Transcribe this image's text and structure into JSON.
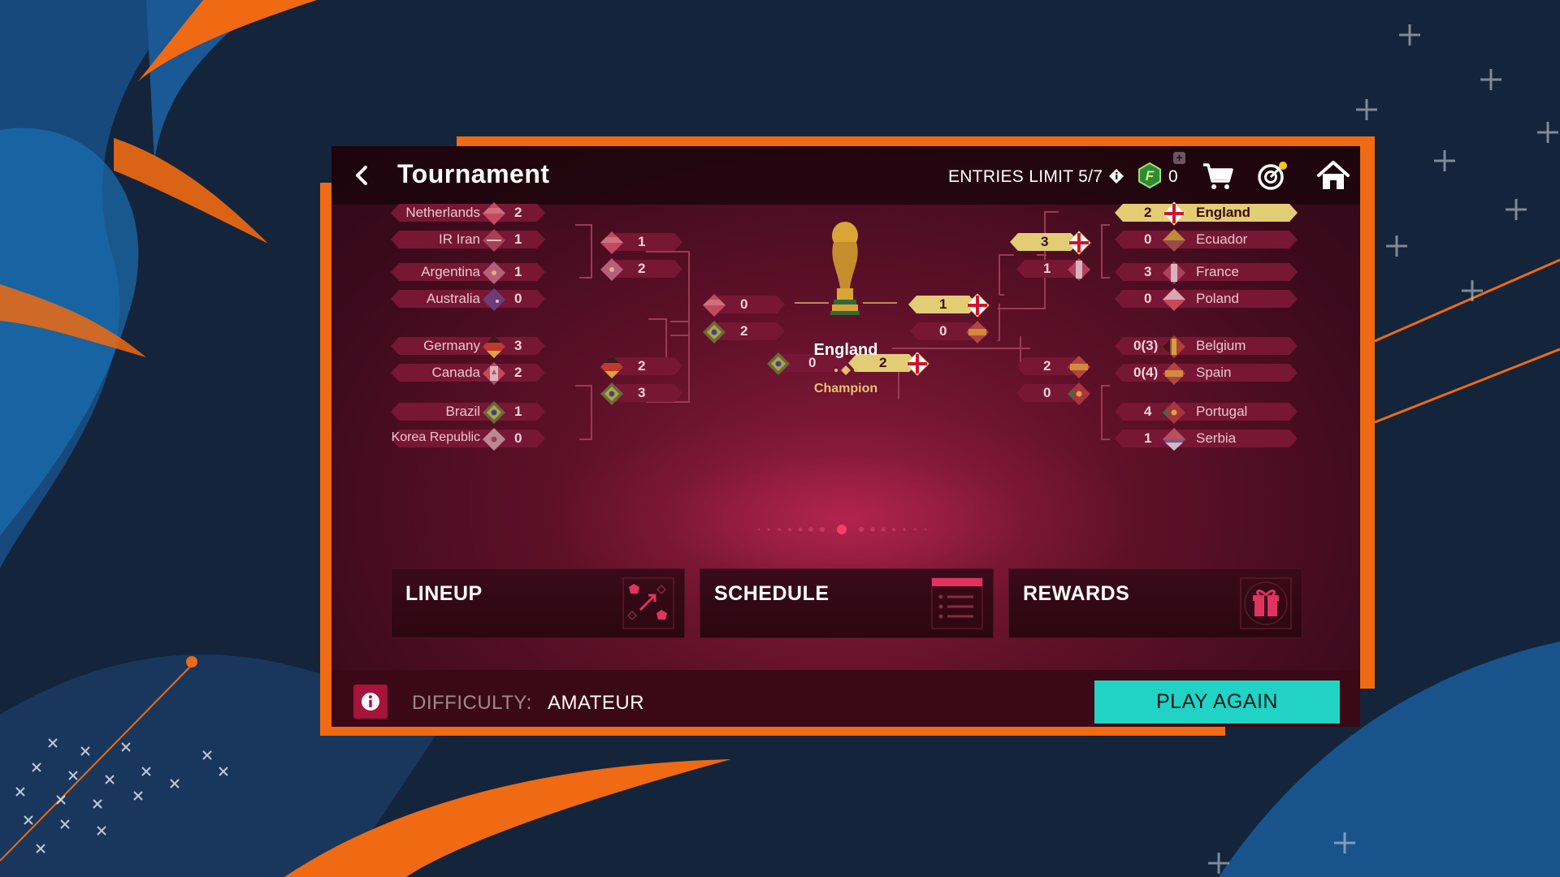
{
  "header": {
    "title": "Tournament",
    "entries_limit": "ENTRIES LIMIT 5/7",
    "coins": "0",
    "coin_plus": "+",
    "icons": [
      "back-arrow-icon",
      "info-icon",
      "fifa-points-icon",
      "cart-icon",
      "target-icon",
      "home-icon"
    ]
  },
  "bracket": {
    "round_of_16_left": [
      {
        "team": "Netherlands",
        "score": "2"
      },
      {
        "team": "IR Iran",
        "score": "1"
      },
      {
        "team": "Argentina",
        "score": "1"
      },
      {
        "team": "Australia",
        "score": "0"
      },
      {
        "team": "Germany",
        "score": "3"
      },
      {
        "team": "Canada",
        "score": "2"
      },
      {
        "team": "Brazil",
        "score": "1"
      },
      {
        "team": "Korea Republic",
        "score": "0"
      }
    ],
    "quarter_left": [
      "1",
      "2",
      "2",
      "3"
    ],
    "semi_left": [
      "0",
      "2"
    ],
    "final": {
      "left": "0",
      "right": "2"
    },
    "third_place": {
      "top": "1",
      "bottom": "0"
    },
    "semi_right": [
      "3",
      "1",
      "2",
      "0"
    ],
    "round_of_16_right": [
      {
        "team": "England",
        "score": "2"
      },
      {
        "team": "Ecuador",
        "score": "0"
      },
      {
        "team": "France",
        "score": "3"
      },
      {
        "team": "Poland",
        "score": "0"
      },
      {
        "team": "Belgium",
        "score": "0(3)"
      },
      {
        "team": "Spain",
        "score": "0(4)"
      },
      {
        "team": "Portugal",
        "score": "4"
      },
      {
        "team": "Serbia",
        "score": "1"
      }
    ],
    "champion": {
      "team": "England",
      "label": "Champion"
    }
  },
  "cards": [
    {
      "label": "LINEUP",
      "icon": "lineup-icon"
    },
    {
      "label": "SCHEDULE",
      "icon": "schedule-icon"
    },
    {
      "label": "REWARDS",
      "icon": "gift-icon"
    }
  ],
  "footer": {
    "difficulty_label": "DIFFICULTY:",
    "difficulty_value": "AMATEUR",
    "play_again": "PLAY AGAIN"
  },
  "colors": {
    "accent_orange": "#ef6a12",
    "winner_gold": "#e3cd74",
    "play_button": "#20d3c4",
    "info_button": "#a7133a"
  }
}
